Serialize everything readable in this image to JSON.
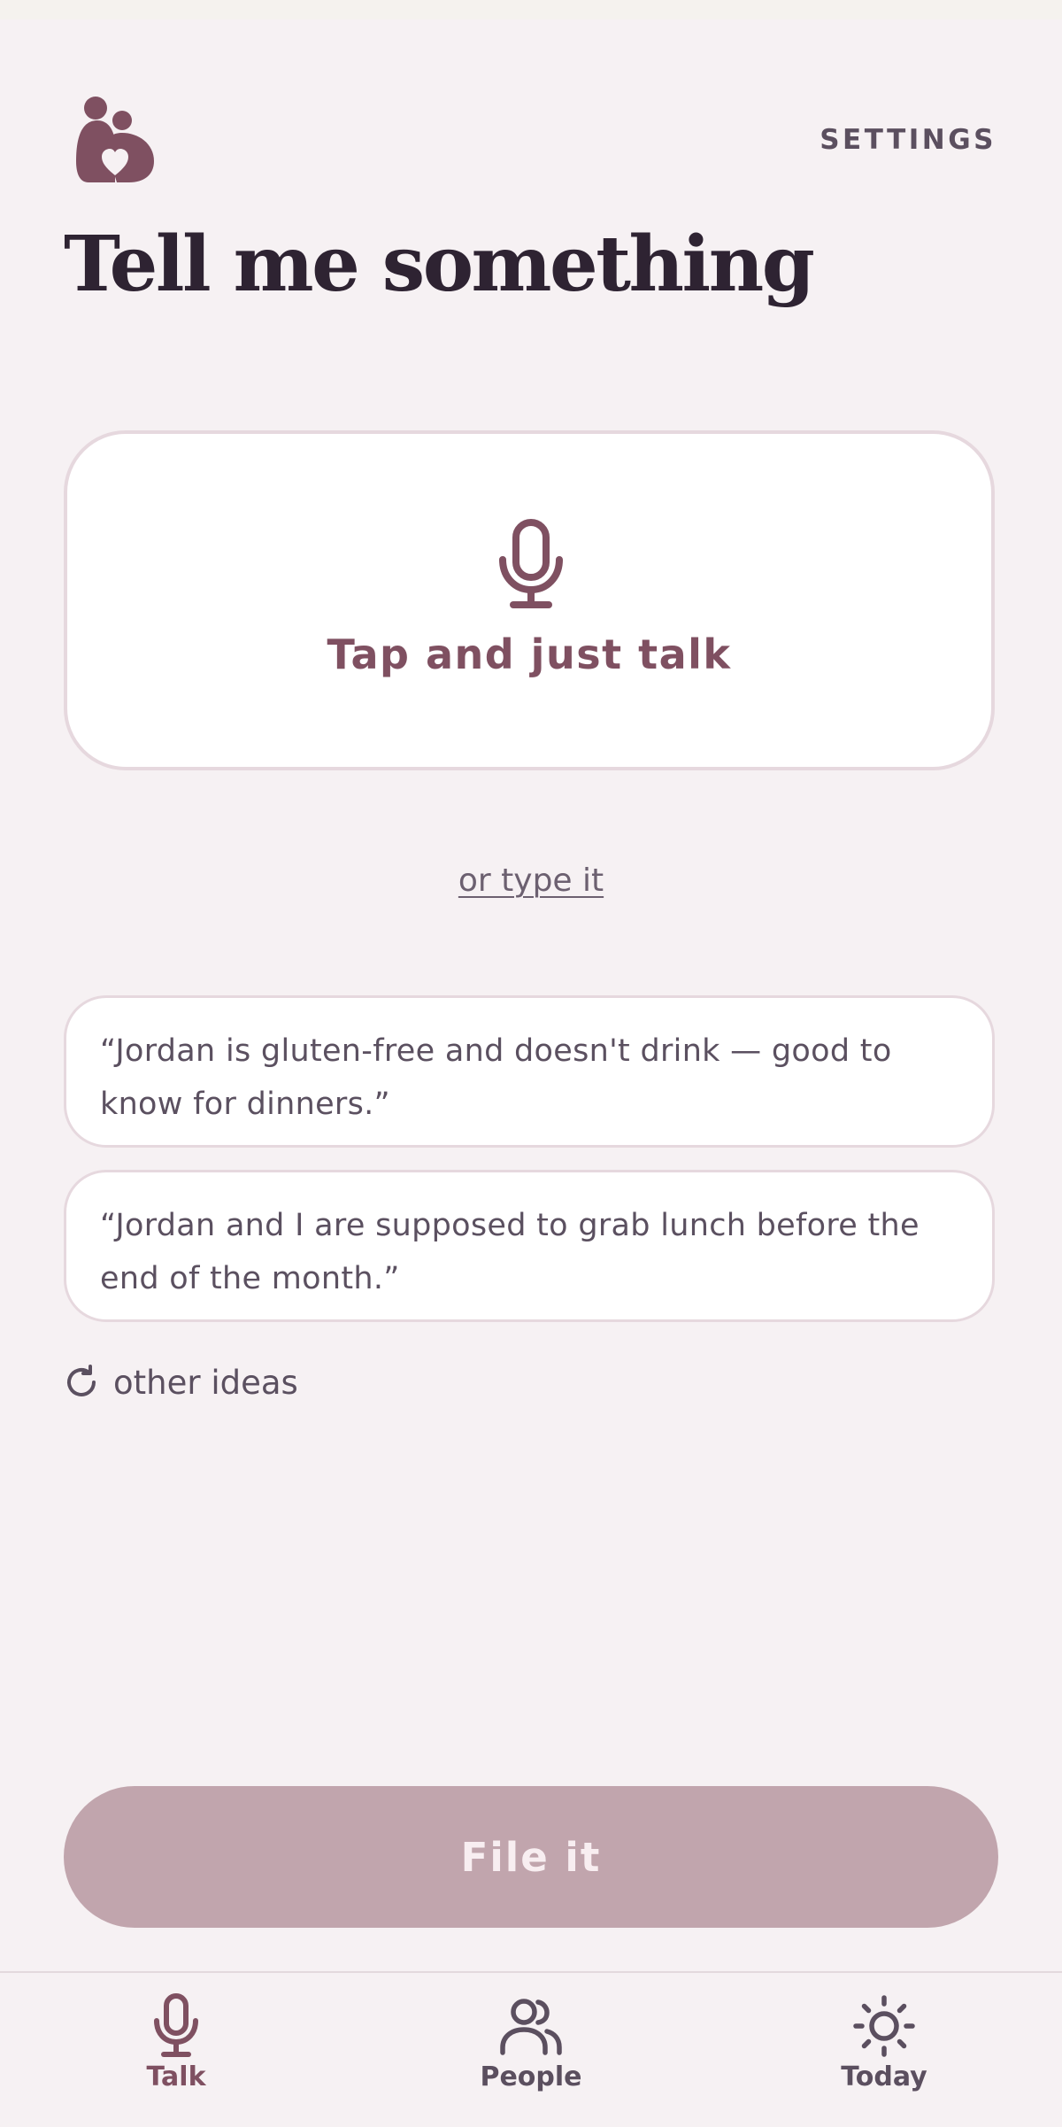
{
  "header": {
    "logo_icon": "two-people-heart-icon",
    "settings_label": "SETTINGS"
  },
  "page_title": "Tell me something",
  "talk_card": {
    "icon": "microphone-icon",
    "label": "Tap and just talk"
  },
  "type_link": "or type it",
  "ideas": [
    "“Jordan is gluten-free and doesn't drink — good to know for dinners.”",
    "“Jordan and I are supposed to grab lunch before the end of the month.”"
  ],
  "other_ideas": {
    "icon": "refresh-icon",
    "label": "other ideas"
  },
  "file_button": {
    "label": "File it",
    "state": "disabled"
  },
  "bottom_nav": {
    "items": [
      {
        "label": "Talk",
        "icon": "microphone-icon",
        "active": true
      },
      {
        "label": "People",
        "icon": "people-icon",
        "active": false
      },
      {
        "label": "Today",
        "icon": "sun-icon",
        "active": false
      }
    ]
  },
  "colors": {
    "background": "#f6f1f3",
    "accent": "#7f5061",
    "title": "#2e2332",
    "button_disabled": "#c1a5ad",
    "card_border": "#e6d8de"
  }
}
